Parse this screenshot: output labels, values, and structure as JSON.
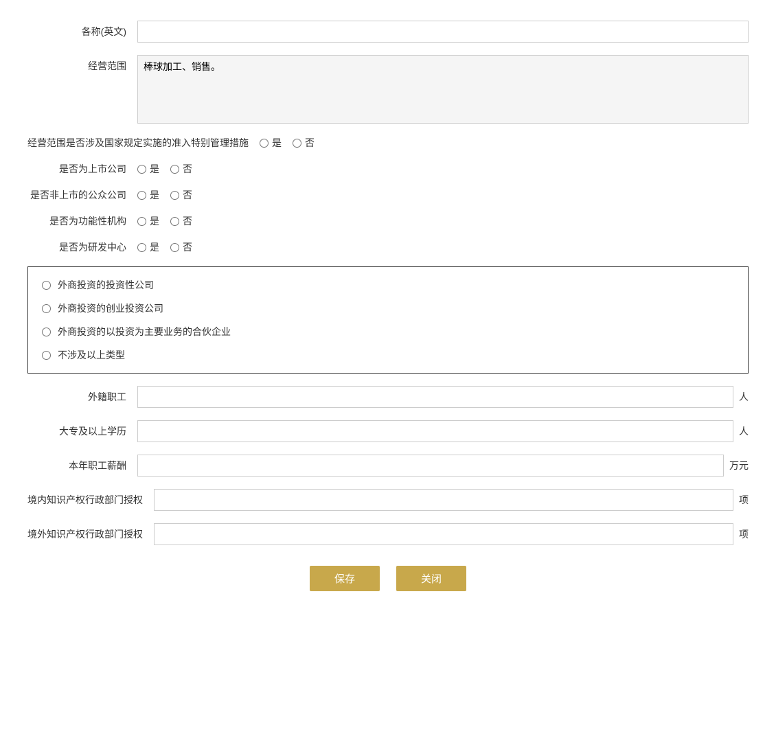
{
  "form": {
    "fields": {
      "english_name_label": "各称(英文)",
      "business_scope_label": "经营范围",
      "business_scope_value": "棒球加工、销售。",
      "special_management_label": "经营范围是否涉及国家规定实施的准入特别管理措施",
      "listed_company_label": "是否为上市公司",
      "non_listed_public_label": "是否非上市的公众公司",
      "functional_org_label": "是否为功能性机构",
      "rd_center_label": "是否为研发中心",
      "yes_label": "是",
      "no_label": "否",
      "foreign_investment_box": {
        "option1": "外商投资的投资性公司",
        "option2": "外商投资的创业投资公司",
        "option3": "外商投资的以投资为主要业务的合伙企业",
        "option4": "不涉及以上类型"
      },
      "foreign_employees_label": "外籍职工",
      "foreign_employees_unit": "人",
      "college_degree_label": "大专及以上学历",
      "college_degree_unit": "人",
      "annual_salary_label": "本年职工薪酬",
      "annual_salary_unit": "万元",
      "domestic_ip_label": "境内知识产权行政部门授权",
      "domestic_ip_unit": "项",
      "foreign_ip_label": "境外知识产权行政部门授权",
      "foreign_ip_unit": "项"
    },
    "buttons": {
      "save_label": "保存",
      "close_label": "关闭"
    }
  }
}
